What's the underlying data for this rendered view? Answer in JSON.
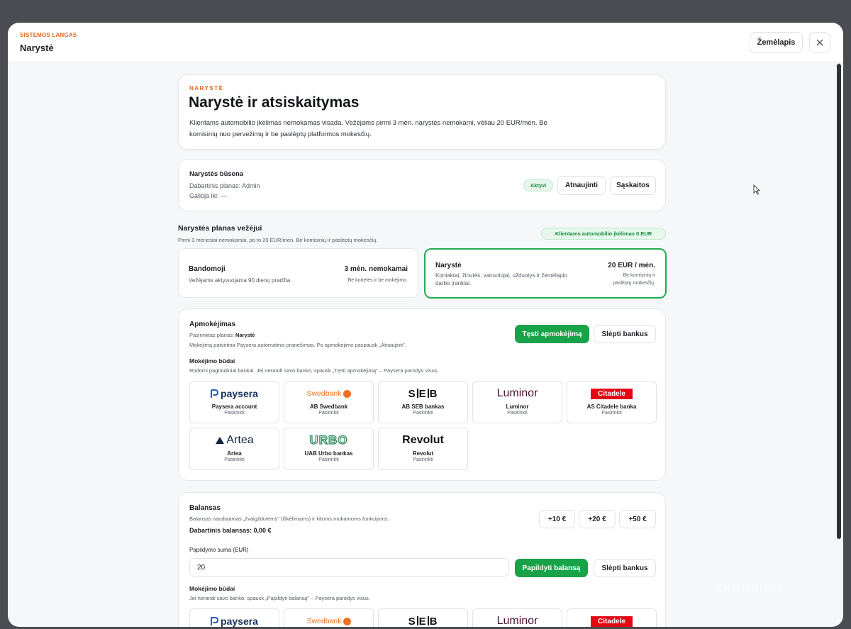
{
  "header": {
    "system_label": "SISTEMOS LANGAS",
    "title": "Narystė",
    "map_button": "Žemėlapis",
    "close_icon": "close-icon"
  },
  "hero": {
    "eyebrow": "NARYSTĖ",
    "title": "Narystė ir atsiskaitymas",
    "description_line1": "Klientams automobilio įkėlimas nemokamas visada. Vežėjams pirmi 3 mėn. narystės nemokami, vėliau 20 EUR/mėn. Be",
    "description_line2": "komisinių nuo pervežimų ir be paslėptų platformos mokesčių."
  },
  "status": {
    "title": "Narystės būsena",
    "plan_line": "Dabartinis planas: Admin",
    "valid_line": "Galioja iki: —",
    "badge": "Aktyvi",
    "refresh_button": "Atnaujinti",
    "invoices_button": "Sąskaitos"
  },
  "plans": {
    "title": "Narystės planas vežėjui",
    "subtitle": "Pirmi 3 mėnesiai nemokamai, po to 20 EUR/mėn. Be komisinių ir paslėptų mokesčių.",
    "badge": "Klientams automobilio įkėlimas 0 EUR",
    "trial": {
      "name": "Bandomoji",
      "price": "3 mėn. nemokamai",
      "description": "Vežėjams aktyvuojama 90 dienų pradžia.",
      "note": "Be kortelės ir be mokėjimo."
    },
    "member": {
      "name": "Narystė",
      "price": "20 EUR / mėn.",
      "description_line1": "Kontaktai, žinutės, vairuotojai, užduotys ir žemėlapio",
      "description_line2": "darbo įrankiai.",
      "note_line1": "Be komisinių ir",
      "note_line2": "paslėptų mokesčių."
    }
  },
  "payment": {
    "title": "Apmokėjimas",
    "selected_label": "Pasirinktas planas:",
    "selected_value": "Narystė",
    "info": "Mokėjimą patvirtina Paysera automatinis pranešimas. Po apmokėjimo paspausk „Atnaujinti\".",
    "continue_button": "Tęsti apmokėjimą",
    "hide_banks_button": "Slėpti bankus",
    "methods_title": "Mokėjimo būdai",
    "methods_hint": "Rodomi pagrindiniai bankai. Jei nerandi savo banko, spausk „Tęsti apmokėjimą\" – Paysera parodys visus.",
    "banks": [
      {
        "logo": "paysera",
        "name": "Paysera account",
        "sub": "Pasirinkti"
      },
      {
        "logo": "Swedbank",
        "name": "AB Swedbank",
        "sub": "Pasirinkti"
      },
      {
        "logo": "S|E|B",
        "name": "AB SEB bankas",
        "sub": "Pasirinkti"
      },
      {
        "logo": "Luminor",
        "name": "Luminor",
        "sub": "Pasirinkti"
      },
      {
        "logo": "Citadele",
        "name": "AS Citadele banka",
        "sub": "Pasirinkti"
      },
      {
        "logo": "Artea",
        "name": "Artea",
        "sub": "Pasirinkti"
      },
      {
        "logo": "URBO",
        "name": "UAB Urbo bankas",
        "sub": "Pasirinkti"
      },
      {
        "logo": "Revolut",
        "name": "Revolut",
        "sub": "Pasirinkti"
      }
    ]
  },
  "balance": {
    "title": "Balansas",
    "description": "Balansas naudojamas „žvaigždutėms\" (iškėlimams) ir kitoms mokamoms funkcijoms.",
    "current": "Dabartinis balansas: 0,00 €",
    "quick": [
      "+10 €",
      "+20 €",
      "+50 €"
    ],
    "amount_label": "Papildymo suma (EUR)",
    "amount_value": "20",
    "topup_button": "Papildyti balansą",
    "hide_banks_button": "Slėpti bankus",
    "methods_title": "Mokėjimo būdai",
    "methods_hint": "Jei nerandi savo banko, spausk „Papildyti balansą\" – Paysera parodys visus.",
    "banks": [
      {
        "logo": "paysera"
      },
      {
        "logo": "Swedbank"
      },
      {
        "logo": "S|E|B"
      },
      {
        "logo": "Luminor"
      },
      {
        "logo": "Citadele"
      }
    ]
  },
  "watermark": "skelbiu.lt",
  "colors": {
    "accent_orange": "#e2691f",
    "accent_green": "#19a348",
    "paysera_blue": "#1f5fbf",
    "swedbank_orange": "#ee7023",
    "luminor_maroon": "#481335",
    "citadele_red": "#e30613",
    "urbo_green": "#2a8a5c"
  }
}
